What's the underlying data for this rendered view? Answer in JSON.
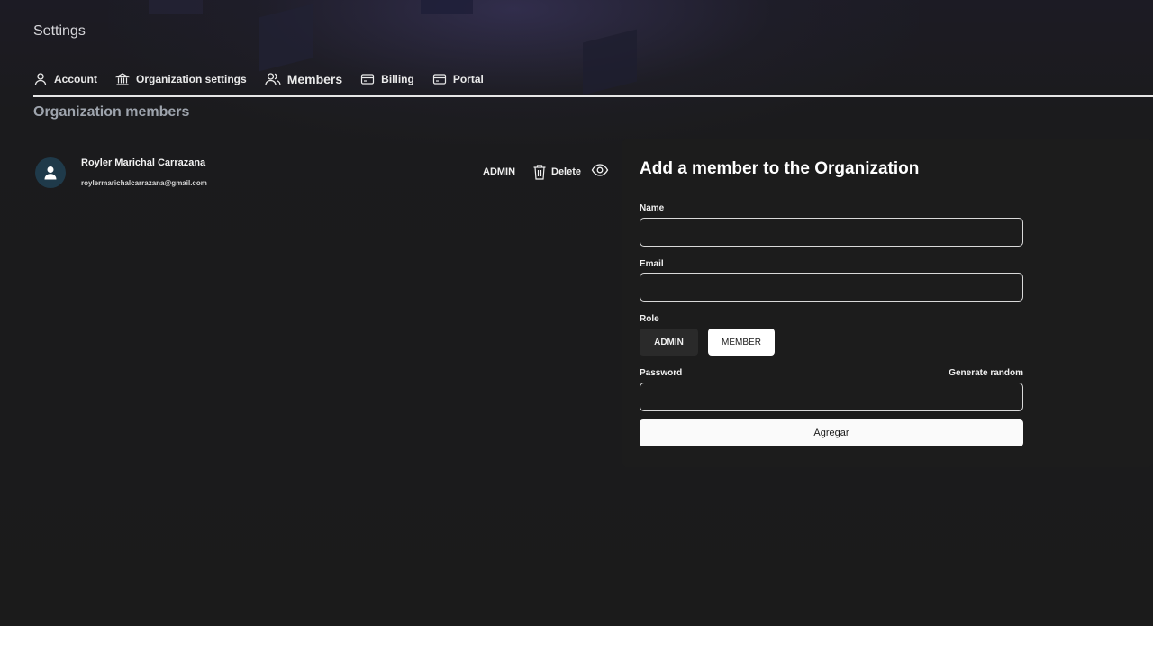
{
  "header": {
    "title": "Settings"
  },
  "tabs": [
    {
      "label": "Account",
      "icon": "user-icon",
      "active": false
    },
    {
      "label": "Organization settings",
      "icon": "bank-icon",
      "active": false
    },
    {
      "label": "Members",
      "icon": "users-icon",
      "active": true
    },
    {
      "label": "Billing",
      "icon": "credit-card-icon",
      "active": false
    },
    {
      "label": "Portal",
      "icon": "credit-card-icon",
      "active": false
    }
  ],
  "section": {
    "title": "Organization members"
  },
  "members": [
    {
      "name": "Royler Marichal Carrazana",
      "email": "roylermarichalcarrazana@gmail.com",
      "role": "ADMIN",
      "delete_label": "Delete"
    }
  ],
  "form": {
    "title": "Add a member to the Organization",
    "name_label": "Name",
    "name_value": "",
    "email_label": "Email",
    "email_value": "",
    "role_label": "Role",
    "roles": [
      "ADMIN",
      "MEMBER"
    ],
    "selected_role": "MEMBER",
    "password_label": "Password",
    "password_value": "",
    "generate_random_label": "Generate random",
    "submit_label": "Agregar"
  },
  "colors": {
    "background": "#1b1b1b",
    "panel": "#1c1c1c",
    "avatar": "#1f3a4a",
    "section_title": "#9ea4ad"
  }
}
